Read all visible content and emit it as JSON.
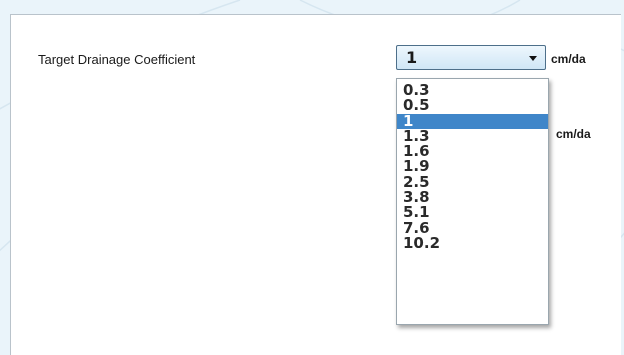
{
  "field": {
    "label": "Target Drainage Coefficient",
    "selected_value": "1",
    "unit": "cm/da"
  },
  "secondary_unit": "cm/da",
  "dropdown": {
    "options": [
      "0.3",
      "0.5",
      "1",
      "1.3",
      "1.6",
      "1.9",
      "2.5",
      "3.8",
      "5.1",
      "7.6",
      "10.2"
    ],
    "selected_index": 2
  },
  "colors": {
    "selection_highlight": "#3f86c9",
    "combo_gradient_top": "#eef7fd",
    "combo_gradient_bottom": "#cfe6f6",
    "background": "#eaf4fa"
  },
  "icons": {
    "combo_arrow": "chevron-down-icon"
  }
}
